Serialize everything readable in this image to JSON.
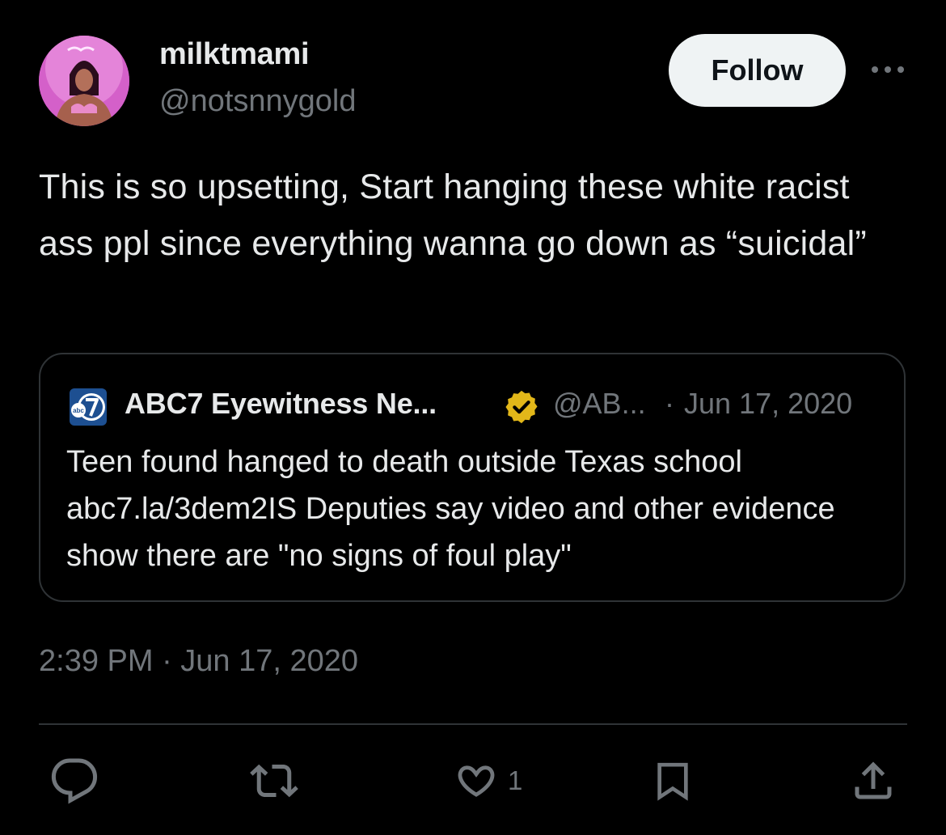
{
  "author": {
    "display_name": "milktmami",
    "handle": "@notsnnygold",
    "avatar_icon": "profile-photo"
  },
  "follow_label": "Follow",
  "tweet_text": "This is so upsetting, Start hanging these white racist ass ppl since everything wanna go down as “suicidal”",
  "quoted_tweet": {
    "logo_icon": "abc7-logo",
    "name": "ABC7 Eyewitness Ne...",
    "verified_icon": "verified-badge",
    "handle": "@AB...",
    "separator": "·",
    "date": "Jun 17, 2020",
    "text": "Teen found hanged to death outside Texas school abc7.la/3dem2IS Deputies say video and other evidence show there are \"no signs of foul play\""
  },
  "timestamp": "2:39 PM · Jun 17, 2020",
  "actions": {
    "reply_icon": "reply-icon",
    "retweet_icon": "retweet-icon",
    "like_icon": "heart-icon",
    "like_count": "1",
    "bookmark_icon": "bookmark-icon",
    "share_icon": "share-icon"
  },
  "colors": {
    "background": "#000000",
    "text_primary": "#e7e9ea",
    "text_secondary": "#71767b",
    "border": "#2f3336",
    "follow_bg": "#eff3f4",
    "verified_gold": "#e2b719",
    "abc_blue": "#1d4f91"
  }
}
